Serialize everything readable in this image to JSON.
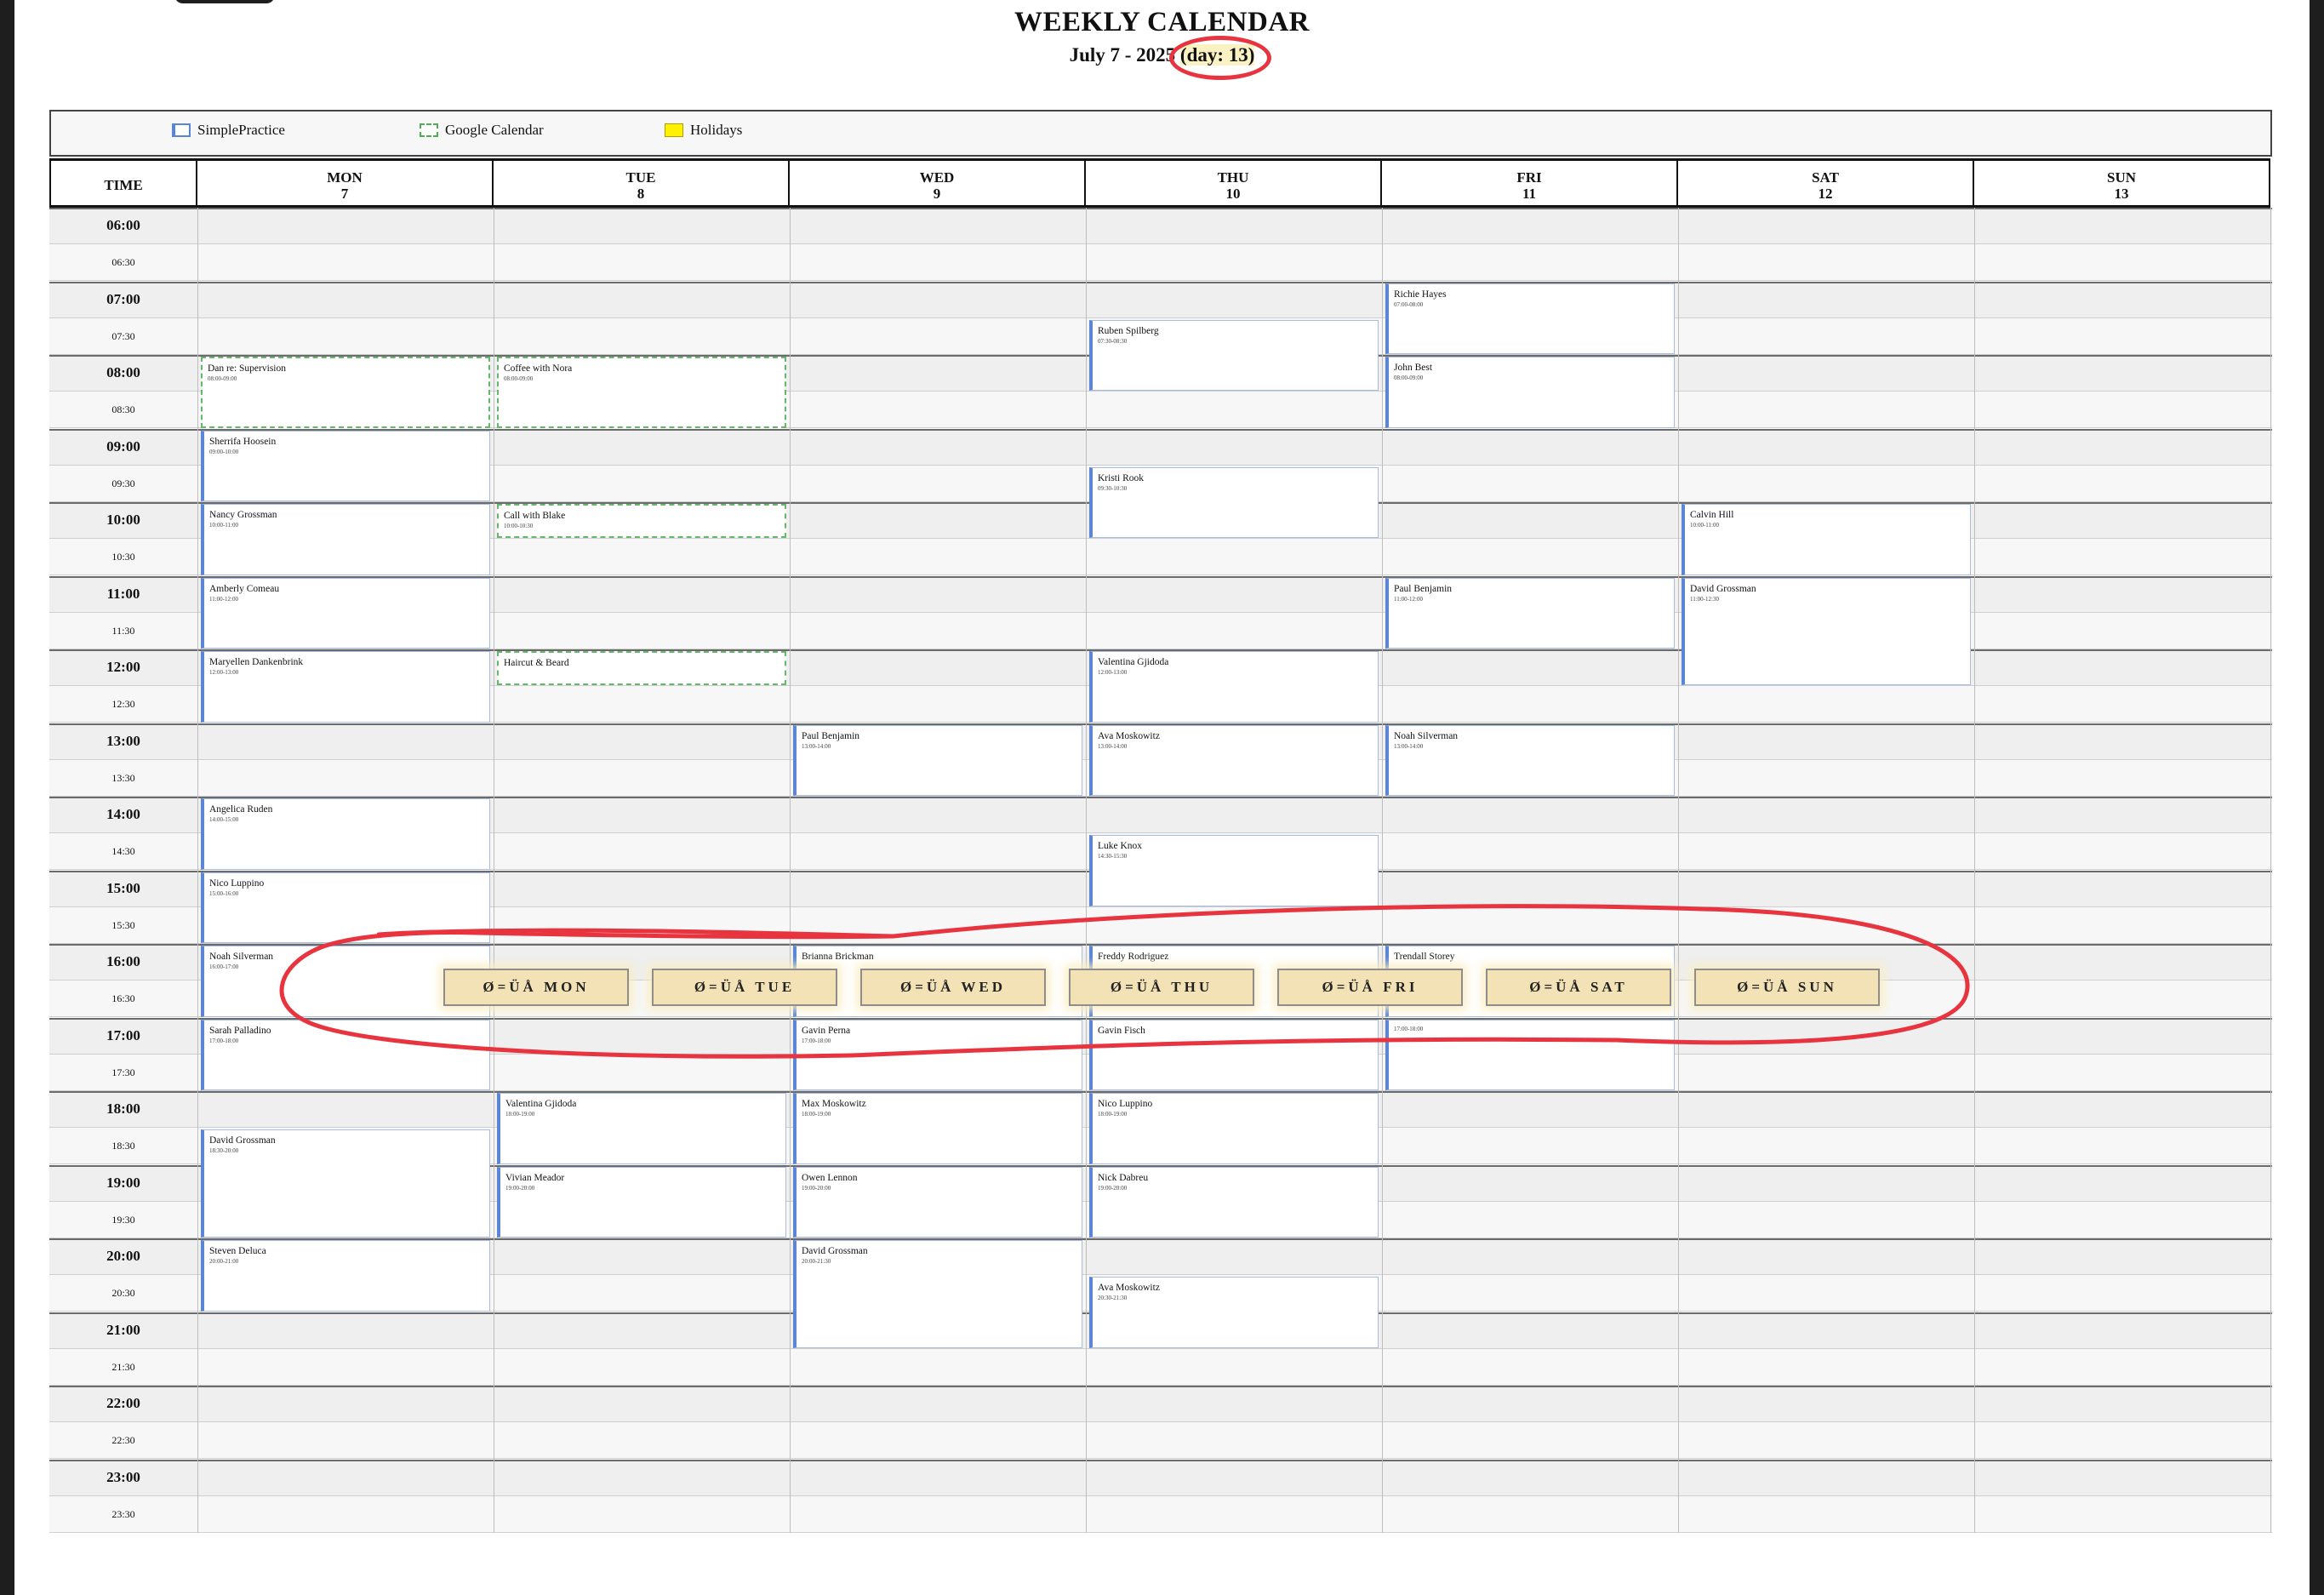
{
  "header": {
    "title": "WEEKLY CALENDAR",
    "date_range": "July 7 - 2025",
    "day_indicator": "(day: 13)"
  },
  "legend": [
    {
      "label": "SimplePractice",
      "kind": "simplepractice"
    },
    {
      "label": "Google Calendar",
      "kind": "google"
    },
    {
      "label": "Holidays",
      "kind": "holiday"
    }
  ],
  "columns": {
    "time_label": "TIME",
    "days": [
      {
        "name": "MON",
        "date": "7"
      },
      {
        "name": "TUE",
        "date": "8"
      },
      {
        "name": "WED",
        "date": "9"
      },
      {
        "name": "THU",
        "date": "10"
      },
      {
        "name": "FRI",
        "date": "11"
      },
      {
        "name": "SAT",
        "date": "12"
      },
      {
        "name": "SUN",
        "date": "13"
      }
    ]
  },
  "time_slots": [
    "06:00",
    "06:30",
    "07:00",
    "07:30",
    "08:00",
    "08:30",
    "09:00",
    "09:30",
    "10:00",
    "10:30",
    "11:00",
    "11:30",
    "12:00",
    "12:30",
    "13:00",
    "13:30",
    "14:00",
    "14:30",
    "15:00",
    "15:30",
    "16:00",
    "16:30",
    "17:00",
    "17:30",
    "18:00",
    "18:30",
    "19:00",
    "19:30",
    "20:00",
    "20:30",
    "21:00",
    "21:30",
    "22:00",
    "22:30",
    "23:00",
    "23:30"
  ],
  "events": [
    {
      "day": 0,
      "start": "08:00",
      "end": "09:00",
      "title": "Dan re: Supervision",
      "time": "08:00-09:00",
      "source": "google"
    },
    {
      "day": 0,
      "start": "09:00",
      "end": "10:00",
      "title": "Sherrifa Hoosein",
      "time": "09:00-10:00",
      "source": "simplepractice"
    },
    {
      "day": 0,
      "start": "10:00",
      "end": "11:00",
      "title": "Nancy Grossman",
      "time": "10:00-11:00",
      "source": "simplepractice"
    },
    {
      "day": 0,
      "start": "11:00",
      "end": "12:00",
      "title": "Amberly Comeau",
      "time": "11:00-12:00",
      "source": "simplepractice"
    },
    {
      "day": 0,
      "start": "12:00",
      "end": "13:00",
      "title": "Maryellen Dankenbrink",
      "time": "12:00-13:00",
      "source": "simplepractice"
    },
    {
      "day": 0,
      "start": "14:00",
      "end": "15:00",
      "title": "Angelica Ruden",
      "time": "14:00-15:00",
      "source": "simplepractice"
    },
    {
      "day": 0,
      "start": "15:00",
      "end": "16:00",
      "title": "Nico Luppino",
      "time": "15:00-16:00",
      "source": "simplepractice"
    },
    {
      "day": 0,
      "start": "16:00",
      "end": "17:00",
      "title": "Noah Silverman",
      "time": "16:00-17:00",
      "source": "simplepractice"
    },
    {
      "day": 0,
      "start": "17:00",
      "end": "18:00",
      "title": "Sarah Palladino",
      "time": "17:00-18:00",
      "source": "simplepractice"
    },
    {
      "day": 0,
      "start": "18:30",
      "end": "20:00",
      "title": "David Grossman",
      "time": "18:30-20:00",
      "source": "simplepractice"
    },
    {
      "day": 0,
      "start": "20:00",
      "end": "21:00",
      "title": "Steven Deluca",
      "time": "20:00-21:00",
      "source": "simplepractice"
    },
    {
      "day": 1,
      "start": "08:00",
      "end": "09:00",
      "title": "Coffee with Nora",
      "time": "08:00-09:00",
      "source": "google"
    },
    {
      "day": 1,
      "start": "10:00",
      "end": "10:30",
      "title": "Call with Blake",
      "time": "10:00-10:30",
      "source": "google"
    },
    {
      "day": 1,
      "start": "12:00",
      "end": "12:30",
      "title": "Haircut & Beard",
      "time": "",
      "source": "google"
    },
    {
      "day": 1,
      "start": "18:00",
      "end": "19:00",
      "title": "Valentina Gjidoda",
      "time": "18:00-19:00",
      "source": "simplepractice"
    },
    {
      "day": 1,
      "start": "19:00",
      "end": "20:00",
      "title": "Vivian Meador",
      "time": "19:00-20:00",
      "source": "simplepractice"
    },
    {
      "day": 2,
      "start": "13:00",
      "end": "14:00",
      "title": "Paul Benjamin",
      "time": "13:00-14:00",
      "source": "simplepractice"
    },
    {
      "day": 2,
      "start": "16:00",
      "end": "17:00",
      "title": "Brianna Brickman",
      "time": "",
      "source": "simplepractice"
    },
    {
      "day": 2,
      "start": "17:00",
      "end": "18:00",
      "title": "Gavin Perna",
      "time": "17:00-18:00",
      "source": "simplepractice"
    },
    {
      "day": 2,
      "start": "18:00",
      "end": "19:00",
      "title": "Max Moskowitz",
      "time": "18:00-19:00",
      "source": "simplepractice"
    },
    {
      "day": 2,
      "start": "19:00",
      "end": "20:00",
      "title": "Owen Lennon",
      "time": "19:00-20:00",
      "source": "simplepractice"
    },
    {
      "day": 2,
      "start": "20:00",
      "end": "21:30",
      "title": "David Grossman",
      "time": "20:00-21:30",
      "source": "simplepractice"
    },
    {
      "day": 3,
      "start": "07:30",
      "end": "08:30",
      "title": "Ruben Spilberg",
      "time": "07:30-08:30",
      "source": "simplepractice"
    },
    {
      "day": 3,
      "start": "09:30",
      "end": "10:30",
      "title": "Kristi Rook",
      "time": "09:30-10:30",
      "source": "simplepractice"
    },
    {
      "day": 3,
      "start": "12:00",
      "end": "13:00",
      "title": "Valentina Gjidoda",
      "time": "12:00-13:00",
      "source": "simplepractice"
    },
    {
      "day": 3,
      "start": "13:00",
      "end": "14:00",
      "title": "Ava Moskowitz",
      "time": "13:00-14:00",
      "source": "simplepractice"
    },
    {
      "day": 3,
      "start": "14:30",
      "end": "15:30",
      "title": "Luke Knox",
      "time": "14:30-15:30",
      "source": "simplepractice"
    },
    {
      "day": 3,
      "start": "16:00",
      "end": "17:00",
      "title": "Freddy Rodriguez",
      "time": "",
      "source": "simplepractice"
    },
    {
      "day": 3,
      "start": "17:00",
      "end": "18:00",
      "title": "Gavin Fisch",
      "time": "",
      "source": "simplepractice"
    },
    {
      "day": 3,
      "start": "18:00",
      "end": "19:00",
      "title": "Nico Luppino",
      "time": "18:00-19:00",
      "source": "simplepractice"
    },
    {
      "day": 3,
      "start": "19:00",
      "end": "20:00",
      "title": "Nick Dabreu",
      "time": "19:00-20:00",
      "source": "simplepractice"
    },
    {
      "day": 3,
      "start": "20:30",
      "end": "21:30",
      "title": "Ava Moskowitz",
      "time": "20:30-21:30",
      "source": "simplepractice"
    },
    {
      "day": 4,
      "start": "07:00",
      "end": "08:00",
      "title": "Richie Hayes",
      "time": "07:00-08:00",
      "source": "simplepractice"
    },
    {
      "day": 4,
      "start": "08:00",
      "end": "09:00",
      "title": "John Best",
      "time": "08:00-09:00",
      "source": "simplepractice"
    },
    {
      "day": 4,
      "start": "11:00",
      "end": "12:00",
      "title": "Paul Benjamin",
      "time": "11:00-12:00",
      "source": "simplepractice"
    },
    {
      "day": 4,
      "start": "13:00",
      "end": "14:00",
      "title": "Noah Silverman",
      "time": "13:00-14:00",
      "source": "simplepractice"
    },
    {
      "day": 4,
      "start": "16:00",
      "end": "17:00",
      "title": "Trendall Storey",
      "time": "",
      "source": "simplepractice"
    },
    {
      "day": 4,
      "start": "17:00",
      "end": "18:00",
      "title": "",
      "time": "17:00-18:00",
      "source": "simplepractice"
    },
    {
      "day": 5,
      "start": "10:00",
      "end": "11:00",
      "title": "Calvin Hill",
      "time": "10:00-11:00",
      "source": "simplepractice"
    },
    {
      "day": 5,
      "start": "11:00",
      "end": "12:30",
      "title": "David Grossman",
      "time": "11:00-12:30",
      "source": "simplepractice"
    }
  ],
  "day_nav_buttons": [
    {
      "label": "Ø=ÜÅ MON"
    },
    {
      "label": "Ø=ÜÅ TUE"
    },
    {
      "label": "Ø=ÜÅ WED"
    },
    {
      "label": "Ø=ÜÅ THU"
    },
    {
      "label": "Ø=ÜÅ FRI"
    },
    {
      "label": "Ø=ÜÅ SAT"
    },
    {
      "label": "Ø=ÜÅ SUN"
    }
  ],
  "colors": {
    "simplepractice": "#5b86d6",
    "google": "#4caf50",
    "holiday": "#fff200",
    "annotation": "#e8343f",
    "highlight": "#fbf2c4"
  }
}
